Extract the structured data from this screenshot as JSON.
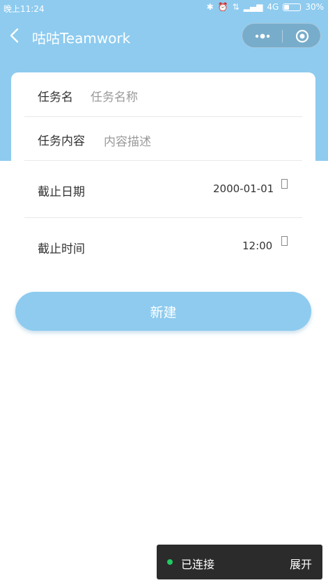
{
  "status_bar": {
    "time": "晚上11:24",
    "network": "4G",
    "battery": "30%"
  },
  "nav": {
    "title": "咕咕Teamwork"
  },
  "form": {
    "task_name_label": "任务名",
    "task_name_placeholder": "任务名称",
    "task_content_label": "任务内容",
    "task_content_placeholder": "内容描述",
    "deadline_date_label": "截止日期",
    "deadline_date_value": "2000-01-01",
    "deadline_time_label": "截止时间",
    "deadline_time_value": "12:00"
  },
  "create_button": "新建",
  "toast": {
    "status": "已连接",
    "expand": "展开"
  },
  "colors": {
    "theme": "#8ecbef",
    "connected": "#1fcb62"
  }
}
